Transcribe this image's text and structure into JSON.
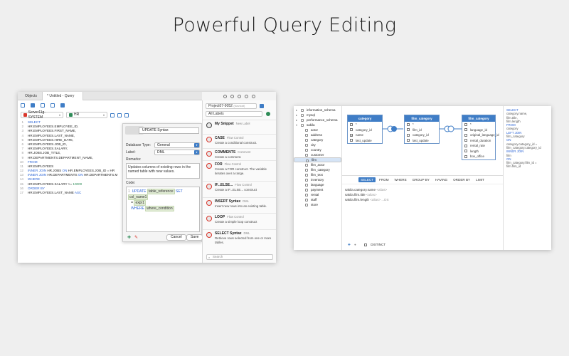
{
  "headline": "Powerful Query Editing",
  "left_window": {
    "tabs": [
      "Objects",
      "* Untitled - Query"
    ],
    "connection": "Server11g-SYSTEM",
    "schema": "HR",
    "code_lines": [
      {
        "n": "1",
        "segs": [
          {
            "t": "SELECT",
            "c": "kw"
          }
        ]
      },
      {
        "n": "2",
        "segs": [
          {
            "t": "HR.EMPLOYEES.EMPLOYEE_ID,",
            "c": ""
          }
        ]
      },
      {
        "n": "3",
        "segs": [
          {
            "t": "HR.EMPLOYEES.FIRST_NAME,",
            "c": ""
          }
        ]
      },
      {
        "n": "4",
        "segs": [
          {
            "t": "HR.EMPLOYEES.LAST_NAME,",
            "c": ""
          }
        ]
      },
      {
        "n": "5",
        "segs": [
          {
            "t": "HR.EMPLOYEES.HIRE_DATE,",
            "c": ""
          }
        ]
      },
      {
        "n": "6",
        "segs": [
          {
            "t": "HR.EMPLOYEES.JOB_ID,",
            "c": ""
          }
        ]
      },
      {
        "n": "7",
        "segs": [
          {
            "t": "HR.EMPLOYEES.SALARY,",
            "c": ""
          }
        ]
      },
      {
        "n": "8",
        "segs": [
          {
            "t": "HR.JOBS.JOB_TITLE,",
            "c": ""
          }
        ]
      },
      {
        "n": "9",
        "segs": [
          {
            "t": "HR.DEPARTMENTS.DEPARTMENT_NAME,",
            "c": ""
          }
        ]
      },
      {
        "n": "10",
        "segs": [
          {
            "t": "FROM",
            "c": "kw"
          }
        ]
      },
      {
        "n": "11",
        "segs": [
          {
            "t": "HR.EMPLOYEES",
            "c": ""
          }
        ]
      },
      {
        "n": "12",
        "segs": [
          {
            "t": "INNER JOIN",
            "c": "kw"
          },
          {
            "t": " HR.JOBS ",
            "c": ""
          },
          {
            "t": "ON",
            "c": "kw"
          },
          {
            "t": " HR.EMPLOYEES.JOB_ID = HR",
            "c": ""
          }
        ]
      },
      {
        "n": "13",
        "segs": [
          {
            "t": "INNER JOIN",
            "c": "kw"
          },
          {
            "t": " HR.DEPARTMENTS ",
            "c": ""
          },
          {
            "t": "ON",
            "c": "kw"
          },
          {
            "t": " HR.DEPARTMENTS.M",
            "c": ""
          }
        ]
      },
      {
        "n": "14",
        "segs": [
          {
            "t": "WHERE",
            "c": "kw"
          }
        ]
      },
      {
        "n": "15",
        "segs": [
          {
            "t": "HR.EMPLOYEES.SALARY >= ",
            "c": ""
          },
          {
            "t": "10000",
            "c": "str"
          }
        ]
      },
      {
        "n": "16",
        "segs": [
          {
            "t": "ORDER BY",
            "c": "kw"
          }
        ]
      },
      {
        "n": "17",
        "segs": [
          {
            "t": "HR.EMPLOYEES.LAST_NAME ",
            "c": ""
          },
          {
            "t": "ASC",
            "c": "kw"
          }
        ]
      }
    ]
  },
  "dialog": {
    "name": "UPDATE Syntax",
    "db_type_label": "Database Type:",
    "db_type_value": "General",
    "label_label": "Label:",
    "label_value": "DML",
    "remarks_label": "Remarks:",
    "remarks": "Updates columns of existing rows in the named table with new values.",
    "code_label": "Code:",
    "code_line_num": "1",
    "code_update": "UPDATE",
    "code_table_ref": "table_reference",
    "code_set": "SET",
    "code_col": "col_name1",
    "code_eq": "=",
    "code_expr": "expr1",
    "code_where": "WHERE",
    "code_cond": "where_condition",
    "cancel": "Cancel",
    "save": "Save"
  },
  "panel": {
    "project": "Project07-9052",
    "project_hint": "(Navicat)",
    "filter": "All Labels",
    "search_placeholder": "Search",
    "snippets": [
      {
        "title": "My Snippet",
        "tag": "New Label",
        "desc": ""
      },
      {
        "title": "CASE",
        "tag": "Flow Control",
        "desc": "Create a conditional construct."
      },
      {
        "title": "COMMENTS",
        "tag": "Comment",
        "desc": "Create a comment."
      },
      {
        "title": "FOR",
        "tag": "Flow Control",
        "desc": "Create a FOR construct. The variable iterates over a range."
      },
      {
        "title": "IF...ELSE...",
        "tag": "Flow Control",
        "desc": "Create a IF...ELSE... construct"
      },
      {
        "title": "INSERT Syntax",
        "tag": "DML",
        "desc": "Insert new rows into an existing table."
      },
      {
        "title": "LOOP",
        "tag": "Flow Control",
        "desc": "Create a simple loop construct"
      },
      {
        "title": "SELECT Syntax",
        "tag": "DML",
        "desc": "Retrieve rows selected from one or more tables."
      }
    ]
  },
  "right_window": {
    "tree": [
      "information_schema",
      "mysql",
      "performance_schema",
      "sakila",
      "actor",
      "address",
      "category",
      "city",
      "country",
      "customer",
      "film",
      "film_actor",
      "film_category",
      "film_text",
      "inventory",
      "language",
      "payment",
      "rental",
      "staff",
      "store"
    ],
    "tables": {
      "category": {
        "name": "category",
        "cols": [
          "*",
          "category_id",
          "name",
          "last_update"
        ]
      },
      "film_category": {
        "name": "film_category",
        "cols": [
          "*",
          "film_id",
          "category_id",
          "last_update"
        ]
      },
      "film_category2": {
        "name": "film_category",
        "cols": [
          "*",
          "language_id",
          "original_language_id",
          "rental_duration",
          "rental_rate",
          "length",
          "box_office"
        ]
      }
    },
    "sql_tabs": [
      "SELECT",
      "FROM",
      "WHERE",
      "GROUP BY",
      "HAVING",
      "ORDER BY",
      "LIMIT"
    ],
    "select_rows": [
      {
        "field": "sakila.category.name",
        "alias": "<alias>"
      },
      {
        "field": "sakila.film.title",
        "alias": "<alias>"
      },
      {
        "field": "sakila.film.length",
        "alias": "<alias> ...DS"
      }
    ],
    "distinct": "DISTINCT",
    "sql_preview": [
      {
        "t": "SELECT",
        "k": true
      },
      {
        "t": "  category.name,",
        "k": false
      },
      {
        "t": "  film.title,",
        "k": false
      },
      {
        "t": "  film.length",
        "k": false
      },
      {
        "t": "FROM",
        "k": true
      },
      {
        "t": "  category",
        "k": false
      },
      {
        "t": "  LEFT JOIN",
        "k": true
      },
      {
        "t": "  film_category",
        "k": false
      },
      {
        "t": "  ON",
        "k": true
      },
      {
        "t": "    category.category_id =",
        "k": false
      },
      {
        "t": "film_category.category_id",
        "k": false
      },
      {
        "t": "  INNER JOIN",
        "k": true
      },
      {
        "t": "  film",
        "k": false
      },
      {
        "t": "  ON",
        "k": true
      },
      {
        "t": "    film_category.film_id =",
        "k": false
      },
      {
        "t": "film.film_id",
        "k": false
      }
    ]
  }
}
